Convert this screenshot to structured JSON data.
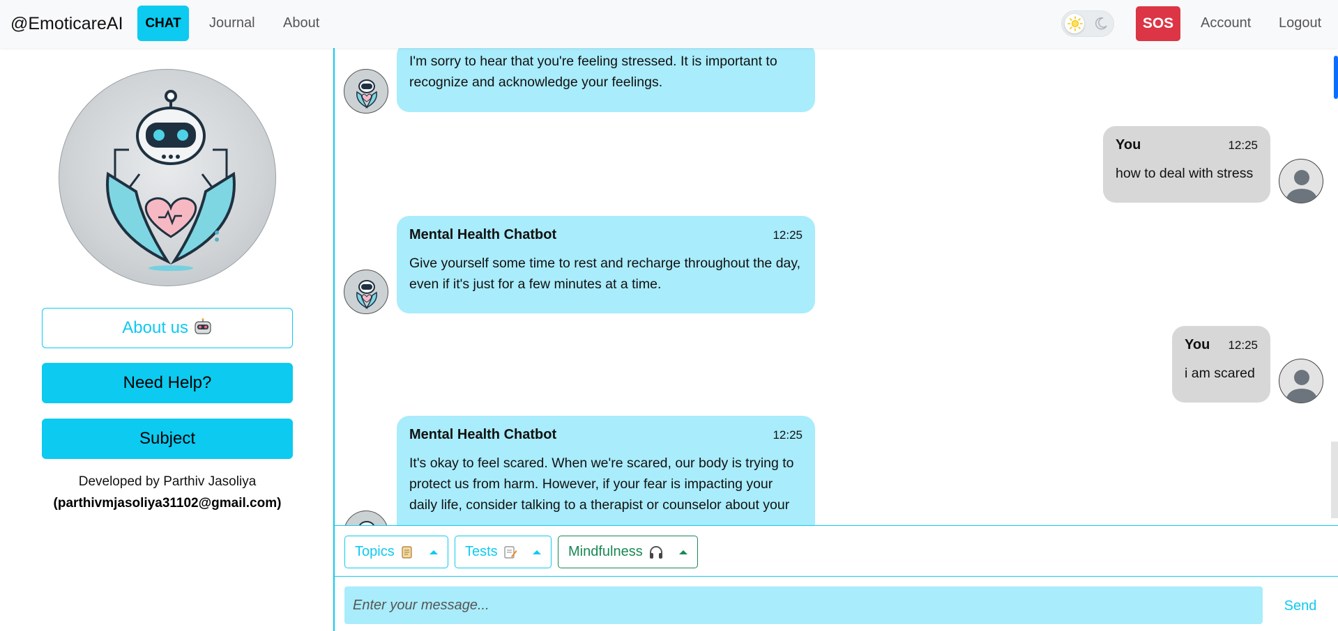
{
  "navbar": {
    "brand": "@EmoticareAI",
    "chat_label": "CHAT",
    "journal_label": "Journal",
    "about_label": "About",
    "sos_label": "SOS",
    "account_label": "Account",
    "logout_label": "Logout"
  },
  "sidebar": {
    "about_us_label": "About us",
    "need_help_label": "Need Help?",
    "subject_label": "Subject",
    "developed_by": "Developed by Parthiv Jasoliya",
    "developer_email": "(parthivmjasoliya31102@gmail.com)"
  },
  "messages": [
    {
      "sender": "",
      "time": "",
      "text": "I'm sorry to hear that you're feeling stressed. It is important to recognize and acknowledge your feelings."
    },
    {
      "sender": "You",
      "time": "12:25",
      "text": "how to deal with stress"
    },
    {
      "sender": "Mental Health Chatbot",
      "time": "12:25",
      "text": "Give yourself some time to rest and recharge throughout the day, even if it's just for a few minutes at a time."
    },
    {
      "sender": "You",
      "time": "12:25",
      "text": "i am scared"
    },
    {
      "sender": "Mental Health Chatbot",
      "time": "12:25",
      "text": "It's okay to feel scared. When we're scared, our body is trying to protect us from harm. However, if your fear is impacting your daily life, consider talking to a therapist or counselor about your"
    }
  ],
  "toolbar": {
    "topics_label": "Topics",
    "tests_label": "Tests",
    "mindfulness_label": "Mindfulness"
  },
  "composer": {
    "placeholder": "Enter your message...",
    "send_label": "Send"
  },
  "colors": {
    "accent": "#0dcaf0",
    "bot_bubble": "#a9ecfb",
    "user_bubble": "#d7d7d7",
    "sos": "#dc3545",
    "success": "#198754"
  }
}
